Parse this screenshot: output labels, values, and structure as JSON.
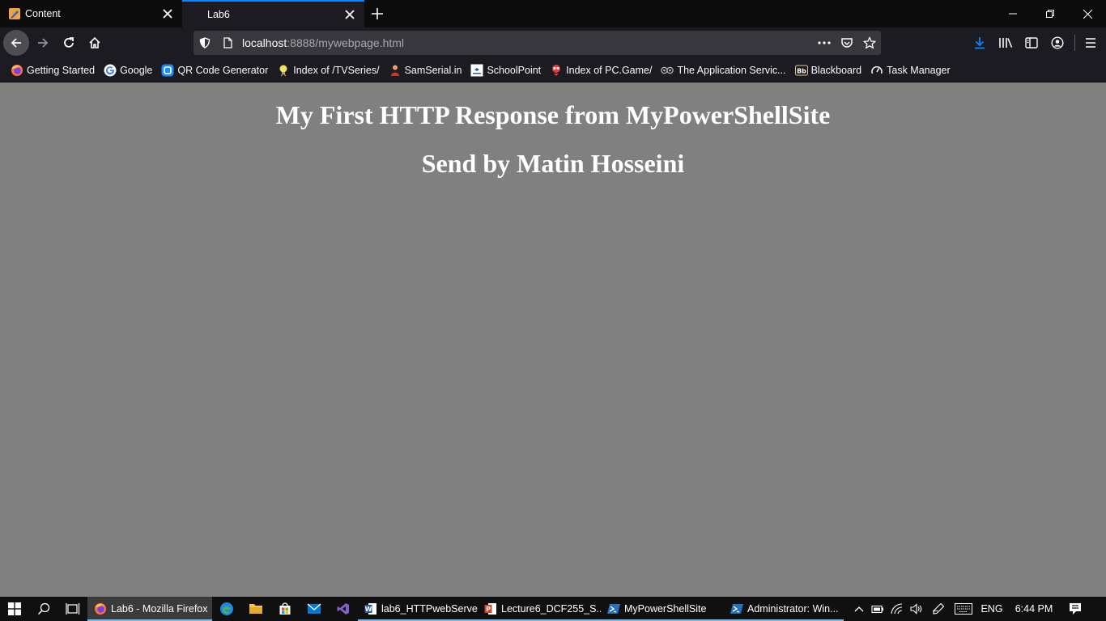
{
  "tabs": [
    {
      "title": "Content",
      "icon": "content-favicon-icon",
      "active": false
    },
    {
      "title": "Lab6",
      "icon": "none",
      "active": true
    }
  ],
  "address_bar": {
    "host": "localhost",
    "rest": ":8888/mywebpage.html"
  },
  "bookmarks": [
    {
      "label": "Getting Started",
      "icon": "firefox-icon"
    },
    {
      "label": "Google",
      "icon": "google-icon"
    },
    {
      "label": "QR Code Generator",
      "icon": "qr-icon"
    },
    {
      "label": "Index of /TVSeries/",
      "icon": "bulb-icon"
    },
    {
      "label": "SamSerial.in",
      "icon": "person-icon"
    },
    {
      "label": "SchoolPoint",
      "icon": "schoolpoint-icon"
    },
    {
      "label": "Index of PC.Game/",
      "icon": "mascot-icon"
    },
    {
      "label": "The Application Servic...",
      "icon": "goggles-icon"
    },
    {
      "label": "Blackboard",
      "icon": "blackboard-icon"
    },
    {
      "label": "Task Manager",
      "icon": "gauge-icon"
    }
  ],
  "page": {
    "heading1": "My First HTTP Response from MyPowerShellSite",
    "heading2": "Send by Matin Hosseini",
    "background": "#808080"
  },
  "taskbar": {
    "apps": [
      {
        "label": "Lab6 - Mozilla Firefox",
        "icon": "firefox-icon",
        "active": true
      },
      {
        "label": "lab6_HTTPwebServe...",
        "icon": "word-icon",
        "active": false
      },
      {
        "label": "Lecture6_DCF255_S...",
        "icon": "powerpoint-icon",
        "active": false
      },
      {
        "label": "MyPowerShellSite",
        "icon": "powershell-icon",
        "active": false
      },
      {
        "label": "Administrator: Win...",
        "icon": "powershell-icon",
        "active": false
      }
    ],
    "language": "ENG",
    "time": "6:44 PM"
  },
  "colors": {
    "accent": "#0a84ff",
    "chrome_dark": "#0c0c0d",
    "toolbar": "#1c1b22",
    "urlbar": "#38373d",
    "taskbar": "#101010",
    "taskbar_underline": "#76b9ed"
  }
}
